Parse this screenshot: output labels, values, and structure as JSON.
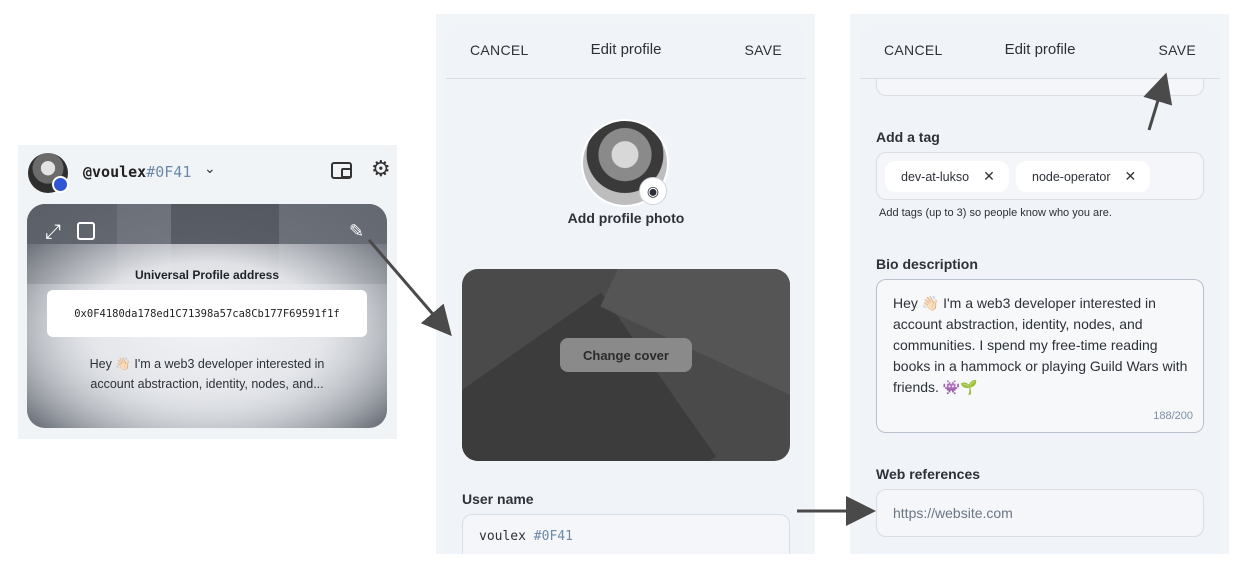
{
  "profile": {
    "handle_name": "@voulex",
    "handle_hash": "#0F41",
    "dropdown_icon": "chevron-down-icon",
    "up_address_label": "Universal Profile address",
    "address": "0x0F4180da178ed1C71398a57ca8Cb177F69591f1f",
    "bio_preview_line1": "Hey 👋🏻 I'm a web3 developer interested in",
    "bio_preview_line2": "account abstraction, identity, nodes, and..."
  },
  "edit_panel": {
    "cancel_label": "CANCEL",
    "title": "Edit profile",
    "save_label": "SAVE",
    "add_photo_label": "Add profile photo",
    "change_cover_label": "Change cover",
    "username_label": "User name",
    "username_value": "voulex",
    "username_hash": "#0F41"
  },
  "edit_panel_2": {
    "cancel_label": "CANCEL",
    "title": "Edit profile",
    "save_label": "SAVE",
    "tag_label": "Add a tag",
    "tags": [
      "dev-at-lukso",
      "node-operator"
    ],
    "tag_hint": "Add tags (up to 3) so people know who you are.",
    "bio_label": "Bio description",
    "bio_text": "Hey 👋🏻 I'm a web3 developer interested in account abstraction, identity, nodes, and communities. I spend my free-time reading books in a hammock or playing Guild Wars with friends. 👾🌱",
    "bio_count": "188/200",
    "web_label": "Web references",
    "web_placeholder": "https://website.com"
  },
  "colors": {
    "hash_accent": "#6c8aa8",
    "panel_bg": "#f0f3f7",
    "badge_blue": "#2f55d4"
  }
}
